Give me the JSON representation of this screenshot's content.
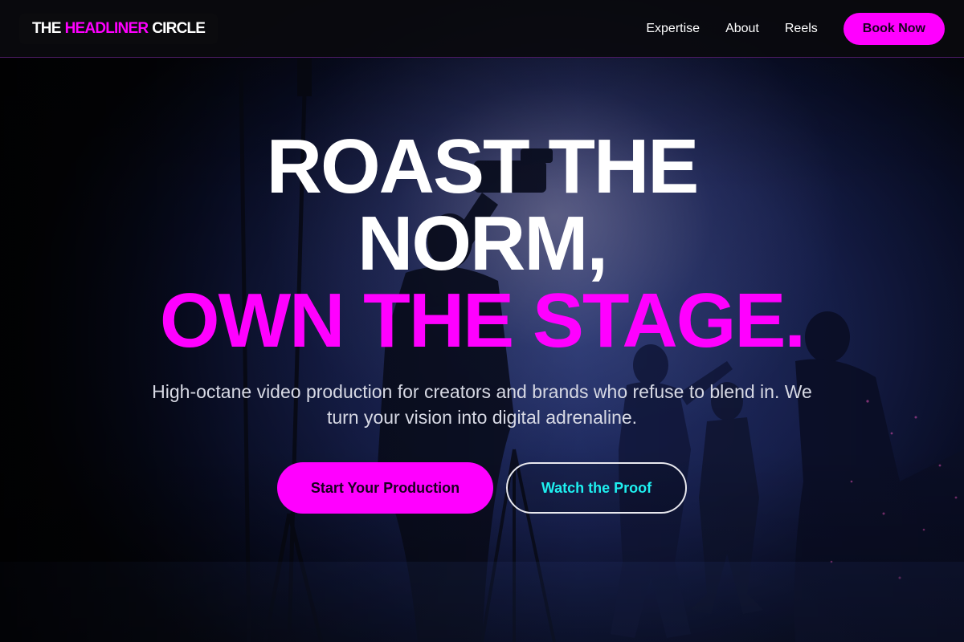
{
  "brand": {
    "logo_part1": "THE",
    "logo_part2": "HEADLINER",
    "logo_part3": "CIRCLE"
  },
  "nav": {
    "items": [
      {
        "label": "Expertise"
      },
      {
        "label": "About"
      },
      {
        "label": "Reels"
      }
    ],
    "cta_label": "Book Now"
  },
  "hero": {
    "headline_line1": "ROAST THE",
    "headline_line2": "NORM,",
    "headline_line3": "OWN THE STAGE.",
    "subtitle": "High-octane video production for creators and brands who refuse to blend in. We turn your vision into digital adrenaline.",
    "primary_cta": "Start Your Production",
    "secondary_cta": "Watch the Proof"
  },
  "colors": {
    "accent": "#ff00ff",
    "secondary_accent": "#1ef0f0",
    "header_bg": "#0a0a0e"
  }
}
